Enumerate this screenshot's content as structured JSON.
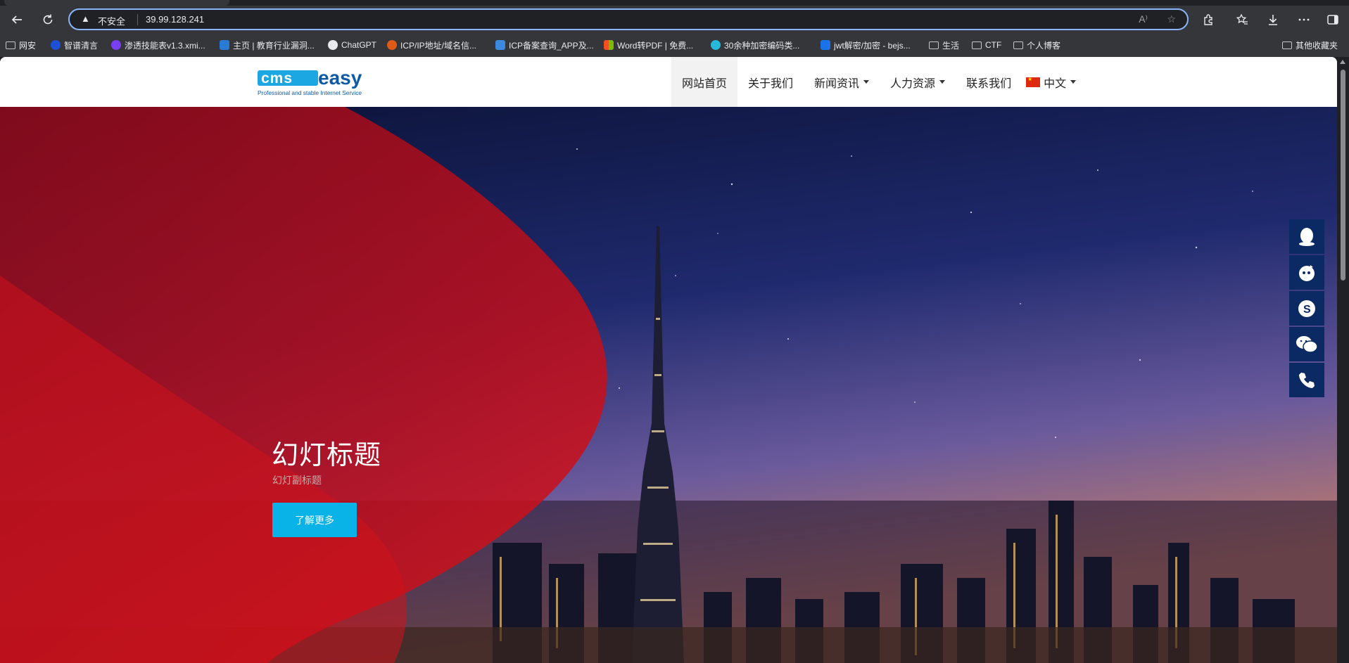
{
  "browser": {
    "address": {
      "security_label": "不安全",
      "url": "39.99.128.241"
    },
    "bookmarks": [
      {
        "label": "网安",
        "icon": "folder-icon"
      },
      {
        "label": "智谱清言",
        "icon": "zhipu-icon"
      },
      {
        "label": "渗透技能表v1.3.xmi...",
        "icon": "xmind-icon"
      },
      {
        "label": "主页 | 教育行业漏洞...",
        "icon": "edusrc-icon"
      },
      {
        "label": "ChatGPT",
        "icon": "openai-icon"
      },
      {
        "label": "ICP/IP地址/域名信...",
        "icon": "icp-icon"
      },
      {
        "label": "ICP备案查询_APP及...",
        "icon": "beian-icon"
      },
      {
        "label": "Word转PDF | 免费...",
        "icon": "word-icon"
      },
      {
        "label": "30余种加密编码类...",
        "icon": "cloud-icon"
      },
      {
        "label": "jwt解密/加密 - bejs...",
        "icon": "bejson-icon"
      },
      {
        "label": "生活",
        "icon": "folder-icon"
      },
      {
        "label": "CTF",
        "icon": "folder-icon"
      },
      {
        "label": "个人博客",
        "icon": "folder-icon"
      }
    ],
    "other_bookmarks": "其他收藏夹"
  },
  "site": {
    "logo": {
      "text": "cmseasy",
      "tagline": "Professional and stable Internet Service"
    },
    "nav": [
      {
        "label": "网站首页",
        "active": true,
        "dropdown": false
      },
      {
        "label": "关于我们",
        "active": false,
        "dropdown": false
      },
      {
        "label": "新闻资讯",
        "active": false,
        "dropdown": true
      },
      {
        "label": "人力资源",
        "active": false,
        "dropdown": true
      },
      {
        "label": "联系我们",
        "active": false,
        "dropdown": false
      }
    ],
    "language": {
      "label": "中文",
      "icon": "china-flag-icon"
    },
    "hero": {
      "title": "幻灯标题",
      "subtitle": "幻灯副标题",
      "button": "了解更多"
    },
    "side_toolbar": [
      "qq-icon",
      "wangwang-icon",
      "skype-icon",
      "wechat-icon",
      "phone-icon"
    ]
  },
  "colors": {
    "accent": "#0ab3e7",
    "side_toolbar": "#0b2a63",
    "hero_red": "#c8141e"
  }
}
